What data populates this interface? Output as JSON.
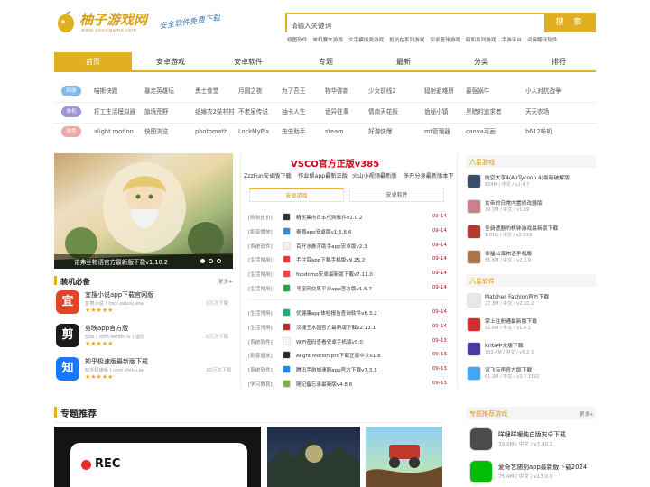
{
  "header": {
    "logo_title": "柚子游戏网",
    "logo_url": "www.youzigame.com",
    "slogan": "安全软件免费下载",
    "search_placeholder": "请输入关键词",
    "search_button": "搜 索",
    "hot_words": [
      "修图软件",
      "单机赛车游戏",
      "文字模拟类游戏",
      "抵抗在系列游戏",
      "安卓篮球游戏",
      "昭和系列游戏",
      "手游平台",
      "词典翻译软件"
    ],
    "accent_color": "#e0b022"
  },
  "nav": {
    "items": [
      "首页",
      "安卓游戏",
      "安卓软件",
      "专题",
      "最新",
      "分类",
      "排行"
    ],
    "active_index": 0
  },
  "tag_rows": [
    {
      "badge": "网游",
      "color": "#86b8e8",
      "items": [
        "喵斯快跑",
        "暴走英雄坛",
        "勇士食堂",
        "月圆之夜",
        "为了吾王",
        "物华弥新",
        "少女前线2",
        "辐射避难所",
        "最强蜗牛",
        "小人对抗战争"
      ]
    },
    {
      "badge": "单机",
      "color": "#9b96d8",
      "items": [
        "打工生活模拟器",
        "旗境荒野",
        "纸嫁衣2奘村村",
        "不老泉传说",
        "抽卡人生",
        "诡异往事",
        "情商天花板",
        "诡秘小镇",
        "黑暗的追求者",
        "天天农场"
      ]
    },
    {
      "badge": "软件",
      "color": "#f2a8a8",
      "items": [
        "alight motion",
        "快图浏览",
        "photomath",
        "LockMyPix",
        "虫虫助手",
        "steam",
        "好游快爆",
        "mt管理器",
        "canva可画",
        "b612咔叽"
      ]
    }
  ],
  "banner": {
    "caption": "诺弗兰物语官方最新版下载v1.10.2"
  },
  "essentials": {
    "title": "装机必备",
    "more": "更多+",
    "apps": [
      {
        "name": "宜搜小说app下载官网版",
        "sub": "宜搜小说 ( com.easou.esa",
        "downloads": "0万次下载",
        "icon_color": "#e24426",
        "icon": "宜"
      },
      {
        "name": "剪映app官方版",
        "sub": "剪映 ( com.lemon.lv ) 进阶",
        "downloads": "0万次下载",
        "icon_color": "#1b1b1b",
        "icon": "剪"
      },
      {
        "name": "知乎极速版最新版下载",
        "sub": "知乎极速版 ( com.zhihu.an",
        "downloads": "10万次下载",
        "icon_color": "#1677ff",
        "icon": "知"
      }
    ]
  },
  "featured": {
    "title": "VSCO官方正版v385",
    "links": [
      "ZzzFun安卓版下载",
      "作业帮app最新正版",
      "火山小视频最新版",
      "多开分身最新版本下"
    ]
  },
  "mid_tabs": [
    "安卓游戏",
    "安卓软件"
  ],
  "mid_list_a": [
    {
      "cat": "[购物比价]",
      "name": "精灵集市日本代购软件v1.0.2",
      "date": "09-14",
      "icon_color": "#333333"
    },
    {
      "cat": "[影音播放]",
      "name": "泰圈app安卓版v1.5.6.6",
      "date": "09-14",
      "icon_color": "#2d8ae5"
    },
    {
      "cat": "[系统软件]",
      "name": "百开水悬浮助手app安卓版v2.3",
      "date": "09-14",
      "icon_color": "#f0f0f0"
    },
    {
      "cat": "[生活常用]",
      "name": "手住赏app下载手机版v9.25.2",
      "date": "09-14",
      "icon_color": "#e53935"
    },
    {
      "cat": "[生活常用]",
      "name": "foodomo安卓最新版下载v7.11.0",
      "date": "09-14",
      "icon_color": "#e94b3c"
    },
    {
      "cat": "[生活常用]",
      "name": "寻宝网交易平台app官方版v1.5.7",
      "date": "09-14",
      "icon_color": "#2aa14a"
    }
  ],
  "mid_list_b": [
    {
      "cat": "[生活常用]",
      "name": "优健康app体检报告查询软件v8.3.2",
      "date": "09-14",
      "icon_color": "#12b07a"
    },
    {
      "cat": "[生活常用]",
      "name": "汉捷王水园官方最新版下载v2.11.1",
      "date": "09-14",
      "icon_color": "#c62828"
    },
    {
      "cat": "[系统软件]",
      "name": "WiFi密码查看安卓手机版v5.0",
      "date": "09-13",
      "icon_color": "#f5f5f5"
    },
    {
      "cat": "[影音播放]",
      "name": "Alight Motion pro下载正版中文v1.8",
      "date": "09-13",
      "icon_color": "#2b2b2b"
    },
    {
      "cat": "[系统软件]",
      "name": "腾讯手游加速器app官方下载v7.3.1",
      "date": "09-13",
      "icon_color": "#1e88e5"
    },
    {
      "cat": "[学习教育]",
      "name": "随记备忘录最新版v4.8.6",
      "date": "09-13",
      "icon_color": "#7cb342"
    }
  ],
  "right_games": {
    "title": "六星游戏",
    "items": [
      {
        "name": "航空大亨4(AirTycoon 4)最新破解版",
        "sub": "924M / 中文 / v1.4.7",
        "icon_color": "#3b4e6b"
      },
      {
        "name": "女帝的日常内置修改器版",
        "sub": "39.7M / 中文 / v1.69",
        "icon_color": "#c9828b"
      },
      {
        "name": "圣骑遗器的棋钟游戏最新版下载",
        "sub": "1.01G / 中文 / v2.019",
        "icon_color": "#b23a2e"
      },
      {
        "name": "幸福公寓物语手机版",
        "sub": "55.6M / 中文 / v2.3.9",
        "icon_color": "#a8744c"
      }
    ]
  },
  "right_apps": {
    "title": "六星软件",
    "items": [
      {
        "name": "Matches Fashion官方下载",
        "sub": "27.3M / 中文 / v2.10.2",
        "icon_color": "#e8e8e8"
      },
      {
        "name": "掌上注册通最新版下载",
        "sub": "51.6M / 中文 / v1.4.1",
        "icon_color": "#d32f2f"
      },
      {
        "name": "Krita中文版下载",
        "sub": "302.4M / 中文 / v5.2.3",
        "icon_color": "#4a3b9c"
      },
      {
        "name": "讯飞有声官方版下载",
        "sub": "61.2M / 中文 / v2.7.3192",
        "icon_color": "#3fa9f5"
      }
    ]
  },
  "topics": {
    "title": "专题推荐",
    "rec_label": "REC"
  },
  "topic_games": {
    "title": "专题推荐游戏",
    "more": "更多+",
    "items": [
      {
        "name": "咩哩咩哩纯白版安卓下载",
        "sub": "39.2M / 中文 / v7.40.1",
        "icon_color": "#4c4c4c"
      },
      {
        "name": "爱奇艺随刻app最新版下载2024",
        "sub": "75.4M / 中文 / v13.0.0",
        "icon_color": "#00be06"
      }
    ]
  },
  "topic_cards": {
    "rec": "#1a1a1a",
    "photo": "#2c3a55",
    "game": "#7ec0ee"
  }
}
